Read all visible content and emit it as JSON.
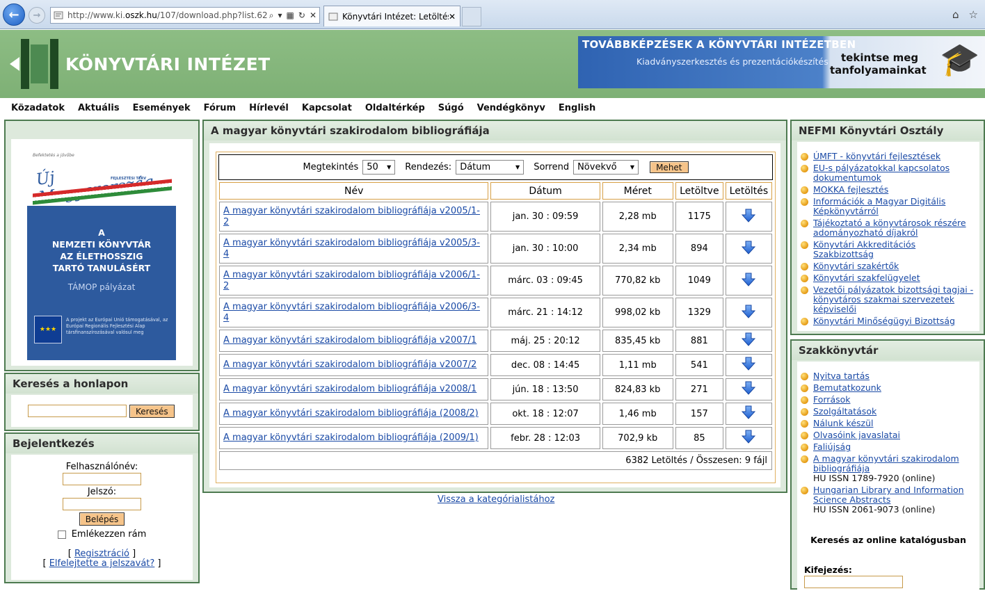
{
  "browser": {
    "url_prefix": "http://www.ki.",
    "url_domain": "oszk.hu",
    "url_suffix": "/107/download.php?list.62",
    "tab_title": "Könyvtári Intézet: Letöltése..."
  },
  "header": {
    "site_title": "KÖNYVTÁRI INTÉZET",
    "banner_title": "TOVÁBBKÉPZÉSEK A KÖNYVTÁRI INTÉZETBEN",
    "banner_sub": "Kiadványszerkesztés és prezentációkészítés",
    "banner_cta_1": "tekintse meg",
    "banner_cta_2": "tanfolyamainkat"
  },
  "menu": [
    "Közadatok",
    "Aktuális",
    "Események",
    "Fórum",
    "Hírlevél",
    "Kapcsolat",
    "Oldaltérkép",
    "Súgó",
    "Vendégkönyv",
    "English"
  ],
  "left": {
    "promo": {
      "slogan": "Befektetés a jövőbe",
      "title": "Új Magyarország",
      "subtitle": "FEJLESZTÉSI TERV",
      "msg1": "A",
      "msg2": "NEMZETI KÖNYVTÁR",
      "msg3": "AZ ÉLETHOSSZIG",
      "msg4": "TARTÓ TANULÁSÉRT",
      "tamop": "TÁMOP pályázat",
      "eu_text": "A projekt az Európai Unió támogatásával, az Európai Regionális Fejlesztési Alap társfinanszírozásával valósul meg"
    },
    "search": {
      "title": "Keresés a honlapon",
      "button": "Keresés",
      "value": ""
    },
    "login": {
      "title": "Bejelentkezés",
      "user_label": "Felhasználónév:",
      "pass_label": "Jelszó:",
      "button": "Belépés",
      "remember": "Emlékezzen rám",
      "register": "Regisztráció",
      "forgot": "Elfelejtette a jelszavát?"
    }
  },
  "main": {
    "title": "A magyar könyvtári szakirodalom bibliográfiája",
    "filters": {
      "view_label": "Megtekintés",
      "view_value": "50",
      "sort_label": "Rendezés:",
      "sort_value": "Dátum",
      "order_label": "Sorrend",
      "order_value": "Növekvő",
      "go": "Mehet"
    },
    "columns": [
      "Név",
      "Dátum",
      "Méret",
      "Letöltve",
      "Letöltés"
    ],
    "rows": [
      {
        "name": "A magyar könyvtári szakirodalom bibliográfiája v2005/1-2",
        "date": "jan. 30 : 09:59",
        "size": "2,28 mb",
        "count": "1175"
      },
      {
        "name": "A magyar könyvtári szakirodalom bibliográfiája v2005/3-4",
        "date": "jan. 30 : 10:00",
        "size": "2,34 mb",
        "count": "894"
      },
      {
        "name": "A magyar könyvtári szakirodalom bibliográfiája v2006/1-2",
        "date": "márc. 03 : 09:45",
        "size": "770,82 kb",
        "count": "1049"
      },
      {
        "name": "A magyar könyvtári szakirodalom bibliográfiája v2006/3-4",
        "date": "márc. 21 : 14:12",
        "size": "998,02 kb",
        "count": "1329"
      },
      {
        "name": "A magyar könyvtári szakirodalom bibliográfiája v2007/1",
        "date": "máj. 25 : 20:12",
        "size": "835,45 kb",
        "count": "881"
      },
      {
        "name": "A magyar könyvtári szakirodalom bibliográfiája v2007/2",
        "date": "dec. 08 : 14:45",
        "size": "1,11 mb",
        "count": "541"
      },
      {
        "name": "A magyar könyvtári szakirodalom bibliográfiája v2008/1",
        "date": "jún. 18 : 13:50",
        "size": "824,83 kb",
        "count": "271"
      },
      {
        "name": "A magyar könyvtári szakirodalom bibliográfiája (2008/2)",
        "date": "okt. 18 : 12:07",
        "size": "1,46 mb",
        "count": "157"
      },
      {
        "name": "A magyar könyvtári szakirodalom bibliográfiája (2009/1)",
        "date": "febr. 28 : 12:03",
        "size": "702,9 kb",
        "count": "85"
      }
    ],
    "summary": "6382 Letöltés / Összesen: 9 fájl",
    "back": "Vissza a kategórialistához"
  },
  "right": {
    "nefmi": {
      "title": "NEFMI Könyvtári Osztály",
      "items": [
        "ÚMFT - könyvtári fejlesztések",
        "EU-s pályázatokkal kapcsolatos dokumentumok",
        "MOKKA fejlesztés",
        "Információk a Magyar Digitális Képkönyvtárról",
        "Tájékoztató a könyvtárosok részére adományozható díjakról",
        "Könyvtári Akkreditációs Szakbizottság",
        "Könyvtári szakértők",
        "Könyvtári szakfelügyelet",
        "Vezetői pályázatok bizottsági tagjai - könyvtáros szakmai szervezetek képviselői",
        "Könyvtári Minőségügyi Bizottság"
      ]
    },
    "szak": {
      "title": "Szakkönyvtár",
      "items": [
        "Nyitva tartás",
        "Bemutatkozunk",
        "Források",
        "Szolgáltatások",
        "Nálunk készül",
        "Olvasóink javaslatai",
        "Faliújság"
      ],
      "bib1": "A magyar könyvtári szakirodalom bibliográfiája",
      "bib1_issn": "HU ISSN 1789-7920 (online)",
      "bib2": "Hungarian Library and Information Science Abstracts",
      "bib2_issn": "HU ISSN 2061-9073 (online)",
      "catalog_title": "Keresés az online katalógusban",
      "expr_label": "Kifejezés:"
    }
  }
}
